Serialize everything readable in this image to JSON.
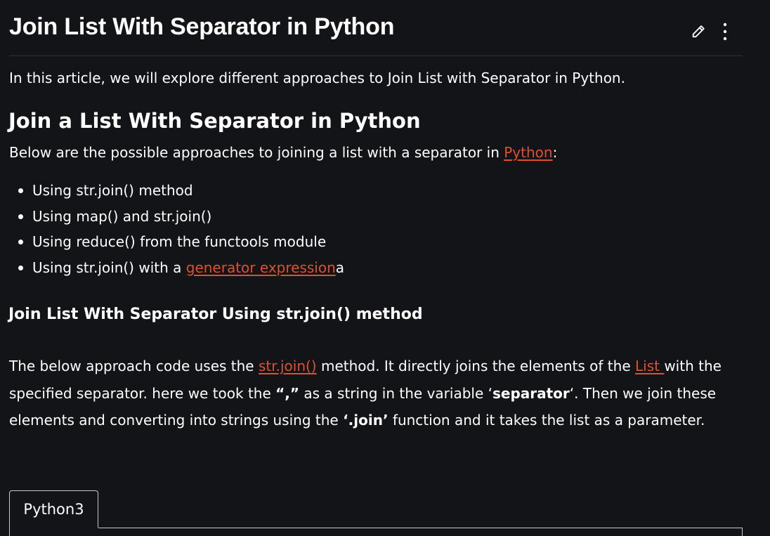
{
  "article": {
    "title": "Join List With Separator in Python",
    "intro": "In this article, we will explore different approaches to Join List with Separator in Python."
  },
  "section": {
    "heading": "Join a List With Separator in Python",
    "desc_before": "Below are the possible approaches to joining a list with a separator in ",
    "desc_link": "Python",
    "desc_after": ":",
    "approaches": {
      "item1": "Using str.join() method",
      "item2": "Using map() and str.join()",
      "item3": "Using reduce() from the functools module",
      "item4_before": "Using str.join() with a ",
      "item4_link": "generator expression",
      "item4_after": "a"
    }
  },
  "subsection": {
    "heading": "Join List With Separator Using str.join() method",
    "para": {
      "t1": "The below approach code uses the ",
      "link1": "str.join()",
      "t2": " method. It directly joins the elements of the ",
      "link2": "List ",
      "t3": "with the specified separator. here we took the ",
      "b1": "“,”",
      "t4": " as a string in the variable ‘",
      "b2": "separator",
      "t5": "‘. Then we join these elements and converting into strings using the ",
      "b3": "‘.join’",
      "t6": " function and it takes the list as a parameter."
    }
  },
  "code_block": {
    "tab_label": "Python3"
  },
  "icons": {
    "edit": "pencil-icon",
    "more": "more-vertical-icon"
  },
  "colors": {
    "background": "#131417",
    "text": "#ffffff",
    "link": "#e0502c",
    "divider": "#2f3136"
  }
}
